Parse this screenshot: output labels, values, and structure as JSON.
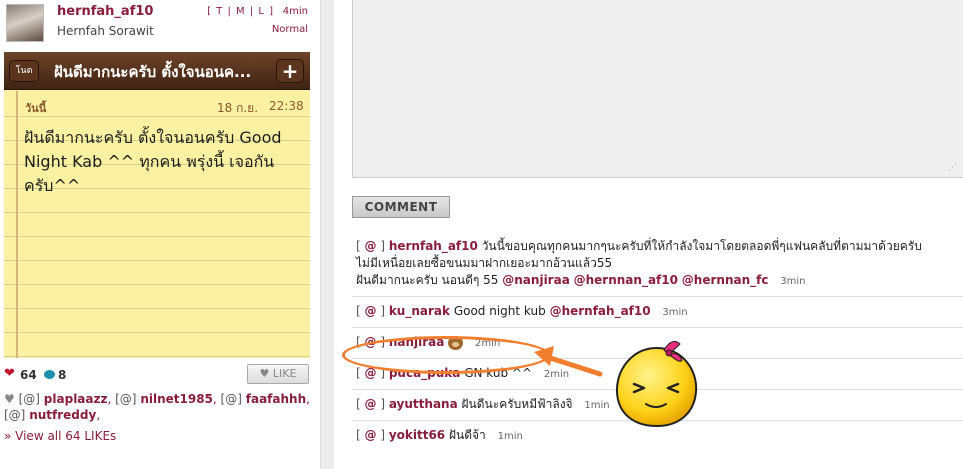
{
  "post": {
    "username": "hernfah_af10",
    "realname": "Hernfah Sorawit",
    "size_links": "[ T | M | L ]",
    "time": "4min",
    "quality": "Normal"
  },
  "notes_app": {
    "back_label": "โนต",
    "title": "ฝันดีมากนะครับ ตั้งใจนอนค...",
    "plus_label": "+",
    "day": "วันนี้",
    "date": "18 ก.ย.",
    "clock": "22:38",
    "body": "ฝันดีมากนะครับ ตั้งใจนอนครับ Good Night Kab ^^ ทุกคน พรุ่งนี้ เจอกัน ครับ^^"
  },
  "stats": {
    "likes": "64",
    "comments": "8",
    "like_button": "LIKE"
  },
  "likers": {
    "bullet": "♥",
    "tag": "[@]",
    "names": [
      "plaplaazz",
      "nilnet1985",
      "faafahhh",
      "nutfreddy"
    ],
    "view_all": "» View all 64 LIKEs"
  },
  "comment_form": {
    "button_label": "COMMENT"
  },
  "comments": [
    {
      "user": "hernfah_af10",
      "text1": "วันนี้ขอบคุณทุกคนมากๆนะครับที่ให้กำลังใจมาโดยตลอดพี่ๆแฟนคลับที่ตามมาด้วยครับ",
      "text2": "ไม่มีเหนื่อยเลยซื้อขนมมาฝากเยอะมากอ้วนแล้ว55",
      "text3": "ฝันดีมากนะครับ นอนดีๆ 55",
      "mentions": [
        "@nanjiraa",
        "@hernnan_af10",
        "@hernnan_fc"
      ],
      "time": "3min"
    },
    {
      "user": "ku_narak",
      "text": "Good night kub",
      "mention": "@hernfah_af10",
      "time": "3min"
    },
    {
      "user": "nanjiraa",
      "icon": "bear-icon",
      "time": "2min"
    },
    {
      "user": "puca_puka",
      "text": "GN kub ^^",
      "time": "2min"
    },
    {
      "user": "ayutthana",
      "text": "ฝันดีนะครับหมีฟ้าลิงจิ",
      "time": "1min"
    },
    {
      "user": "yokitt66",
      "text": "ฝันดีจ้า",
      "time": "1min"
    }
  ],
  "tag_label": "@",
  "colors": {
    "accent": "#8a1d3c",
    "highlight": "#f07e2e",
    "note_paper": "#fbf1a3",
    "notes_bar": "#5a341d"
  }
}
